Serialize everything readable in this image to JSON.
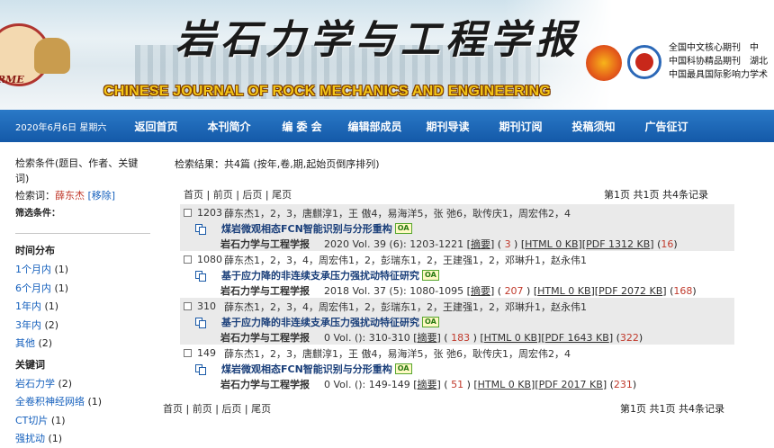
{
  "header": {
    "title_cn": "岩石力学与工程学报",
    "title_en": "CHINESE JOURNAL OF ROCK MECHANICS AND ENGINEERING",
    "logo_text": "RME",
    "honors": [
      "全国中文核心期刊　中",
      "中国科协精品期刊　湖北",
      "中国最具国际影响力学术"
    ]
  },
  "nav": {
    "date": "2020年6月6日 星期六",
    "items": [
      "返回首页",
      "本刊简介",
      "编 委 会",
      "编辑部成员",
      "期刊导读",
      "期刊订阅",
      "投稿须知",
      "广告征订"
    ]
  },
  "sidebar": {
    "cond_label": "检索条件(题目、作者、关键词)",
    "kw_label": "检索词：",
    "kw_value": "薛东杰",
    "remove": "[移除]",
    "filter_label": "筛选条件：",
    "time_title": "时间分布",
    "time_items": [
      {
        "label": "1个月内",
        "count": "(1)"
      },
      {
        "label": "6个月内",
        "count": "(1)"
      },
      {
        "label": "1年内",
        "count": "(1)"
      },
      {
        "label": "3年内",
        "count": "(2)"
      },
      {
        "label": "其他",
        "count": "(2)"
      }
    ],
    "kw_title": "关键词",
    "kw_items": [
      {
        "label": "岩石力学",
        "count": "(2)"
      },
      {
        "label": "全卷积神经网络",
        "count": "(1)"
      },
      {
        "label": "CT切片",
        "count": "(1)"
      },
      {
        "label": "强扰动",
        "count": "(1)"
      }
    ]
  },
  "results": {
    "summary": "检索结果：共4篇 (按年,卷,期,起始页倒序排列)",
    "pager": [
      "首页",
      "前页",
      "后页",
      "尾页"
    ],
    "pager_sep": " | ",
    "page_info": "第1页 共1页 共4条记录",
    "records": [
      {
        "id": "1203",
        "authors": "薛东杰1，2，3，唐麒淳1，王 傲4，易海洋5，张 弛6，耿传庆1，周宏伟2，4",
        "title": "煤岩微观相态FCN智能识别与分形重构",
        "oa": "OA",
        "journal": "岩石力学与工程学报",
        "cite": "2020 Vol. 39 (6): 1203-1221",
        "abstract": "摘要",
        "abstract_count": "3",
        "html": "HTML 0 KB",
        "pdf": "PDF 1312 KB",
        "pdf_count": "16"
      },
      {
        "id": "1080",
        "authors": "薛东杰1，2，3，4，周宏伟1，2，彭瑞东1，2，王建强1，2，邓琳升1，赵永伟1",
        "title": "基于应力降的非连续支承压力强扰动特征研究",
        "oa": "OA",
        "journal": "岩石力学与工程学报",
        "cite": "2018 Vol. 37 (5): 1080-1095",
        "abstract": "摘要",
        "abstract_count": "207",
        "html": "HTML 0 KB",
        "pdf": "PDF 2072 KB",
        "pdf_count": "168"
      },
      {
        "id": "310",
        "authors": "薛东杰1，2，3，4，周宏伟1，2，彭瑞东1，2，王建强1，2，邓琳升1，赵永伟1",
        "title": "基于应力降的非连续支承压力强扰动特征研究",
        "oa": "OA",
        "journal": "岩石力学与工程学报",
        "cite": "0 Vol. (): 310-310",
        "abstract": "摘要",
        "abstract_count": "183",
        "html": "HTML 0 KB",
        "pdf": "PDF 1643 KB",
        "pdf_count": "322"
      },
      {
        "id": "149",
        "authors": "薛东杰1，2，3，唐麒淳1，王 傲4，易海洋5，张 弛6，耿传庆1，周宏伟2，4",
        "title": "煤岩微观相态FCN智能识别与分形重构",
        "oa": "OA",
        "journal": "岩石力学与工程学报",
        "cite": "0 Vol. (): 149-149",
        "abstract": "摘要",
        "abstract_count": "51",
        "html": "HTML 0 KB",
        "pdf": "PDF 2017 KB",
        "pdf_count": "231"
      }
    ]
  },
  "colors": {
    "nav_bg": "#1459a8",
    "link": "#1560bd",
    "accent_red": "#c0392b",
    "row_shade": "#eaeaea"
  }
}
